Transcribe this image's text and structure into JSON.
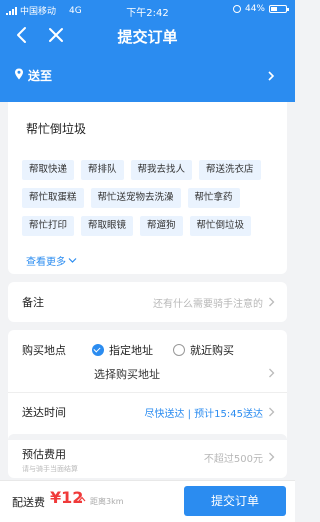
{
  "status_bar": {
    "carrier": "中国移动",
    "network": "4G",
    "time": "下午2:42",
    "battery": "44%",
    "battery_level": 0.44
  },
  "nav": {
    "title": "提交订单",
    "back_icon": "back-arrow-icon",
    "close_icon": "close-icon"
  },
  "deliver": {
    "label": "送至",
    "icon": "location-pin-icon"
  },
  "item": {
    "title": "帮忙倒垃圾",
    "tags": [
      "帮取快递",
      "帮排队",
      "帮我去找人",
      "帮送洗衣店",
      "帮忙取蛋糕",
      "帮忙送宠物去洗澡",
      "帮忙拿药",
      "帮忙打印",
      "帮取眼镜",
      "帮遛狗",
      "帮忙倒垃圾"
    ],
    "see_more": "查看更多"
  },
  "note": {
    "label": "备注",
    "placeholder": "还有什么需要骑手注意的"
  },
  "purchase": {
    "label": "购买地点",
    "option_specified": "指定地址",
    "option_nearby": "就近购买",
    "select_address": "选择购买地址",
    "time_label": "送达时间",
    "time_value": "尽快送达 | 预计15:45送达"
  },
  "fee": {
    "label": "预估费用",
    "sub": "请与骑手当面结算",
    "value": "不超过500元"
  },
  "bottom": {
    "fee_label": "配送费",
    "fee_price": "¥12",
    "distance": "距离3km",
    "submit": "提交订单"
  },
  "colors": {
    "primary": "#2b8cf0",
    "price": "#f03a3a",
    "tag_bg": "#eaf3fe"
  }
}
